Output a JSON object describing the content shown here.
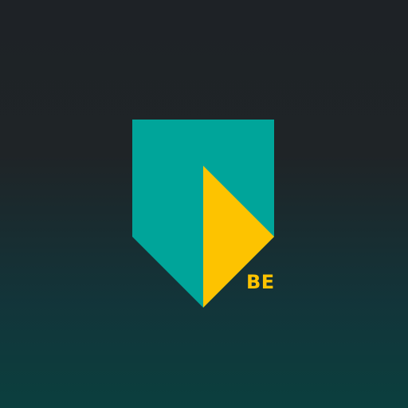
{
  "icon": {
    "region_label": "BE",
    "colors": {
      "shield": "#00a59a",
      "triangle": "#fdc300",
      "label": "#fdc300",
      "background_top": "#1e2226",
      "background_bottom": "#0b3f3e"
    }
  }
}
